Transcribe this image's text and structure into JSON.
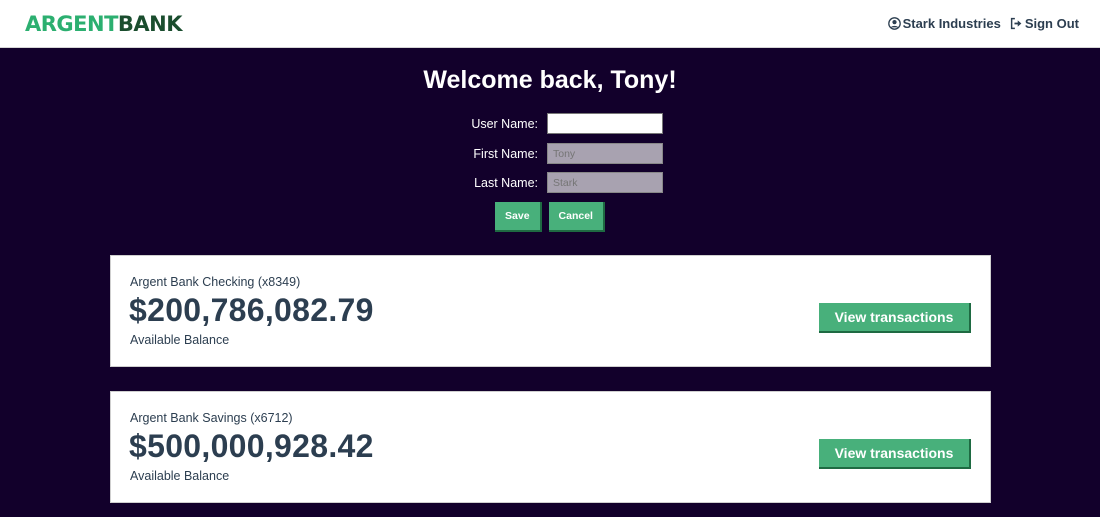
{
  "brand": {
    "part1": "ARGENT",
    "part2": "BANK"
  },
  "nav": {
    "user_label": "Stark Industries",
    "user_icon": "user-circle-icon",
    "signout_label": "Sign Out",
    "signout_icon": "sign-out-icon"
  },
  "welcome": "Welcome back, Tony!",
  "form": {
    "username_label": "User Name:",
    "username_value": "",
    "firstname_label": "First Name:",
    "firstname_placeholder": "Tony",
    "lastname_label": "Last Name:",
    "lastname_placeholder": "Stark",
    "save_label": "Save",
    "cancel_label": "Cancel"
  },
  "accounts": [
    {
      "title": "Argent Bank Checking (x8349)",
      "amount": "$200,786,082.79",
      "description": "Available Balance",
      "button": "View transactions"
    },
    {
      "title": "Argent Bank Savings (x6712)",
      "amount": "$500,000,928.42",
      "description": "Available Balance",
      "button": "View transactions"
    }
  ],
  "colors": {
    "background": "#12002b",
    "accent": "#48b07b",
    "text_dark": "#2c3e50"
  }
}
